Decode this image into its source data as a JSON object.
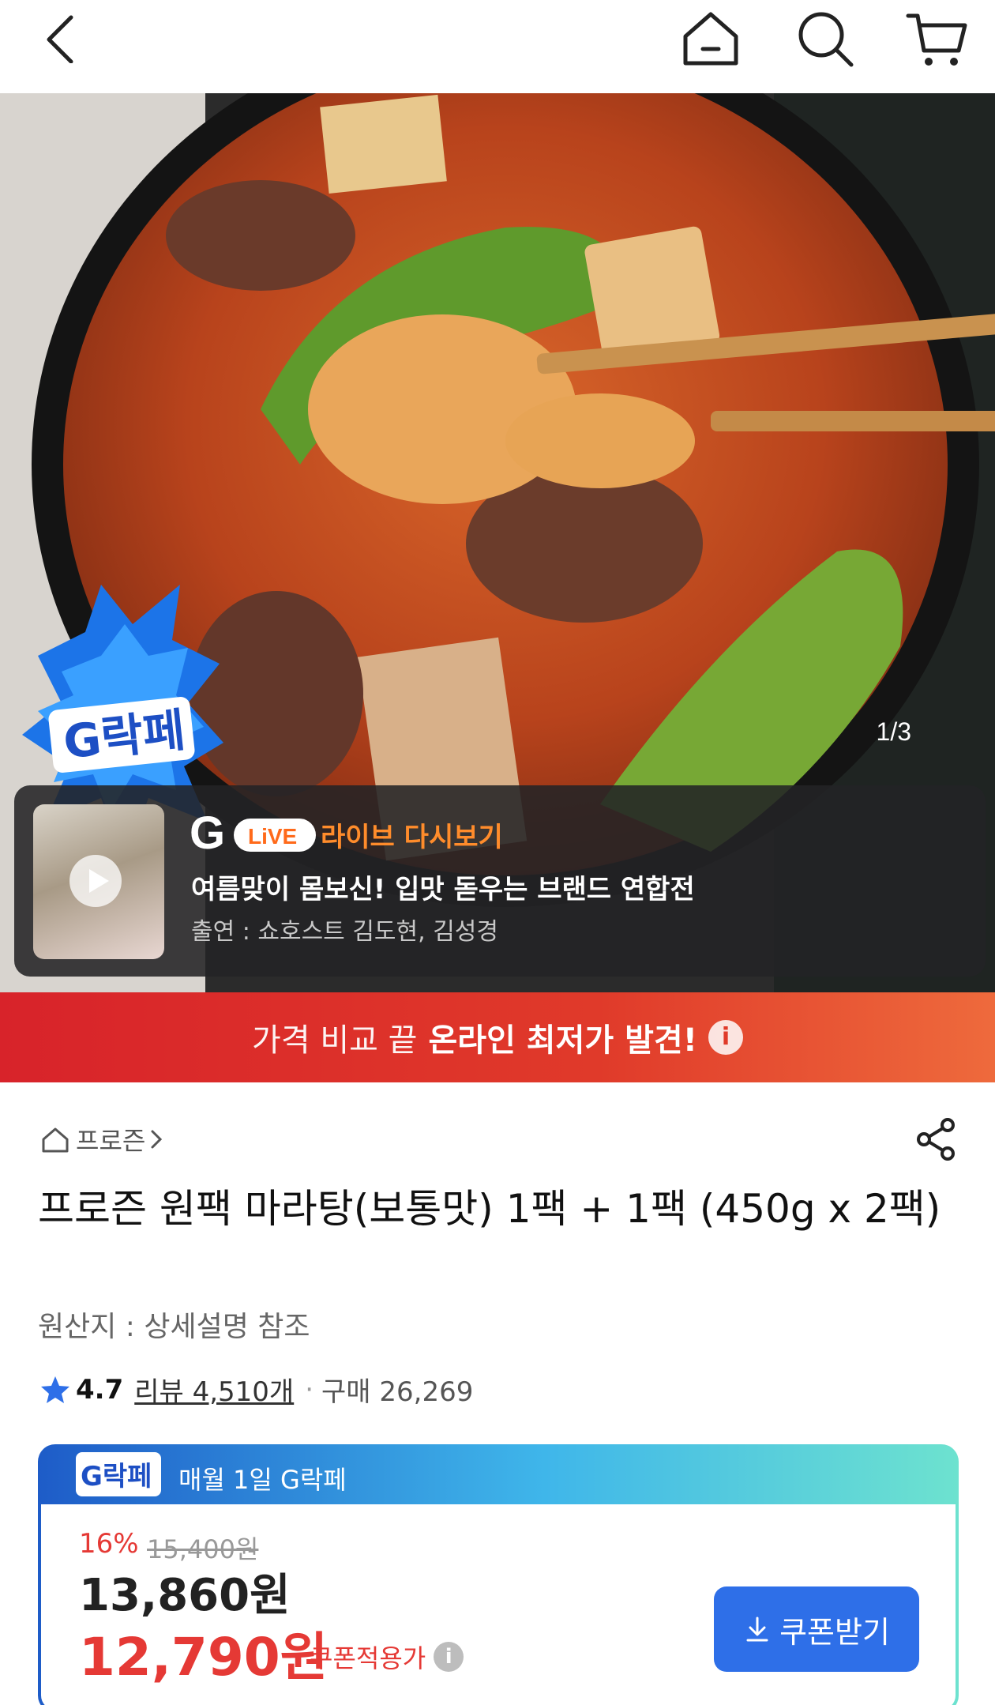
{
  "nav": {
    "back_icon": "chevron-left-icon",
    "home_icon": "home-icon",
    "search_icon": "search-icon",
    "cart_icon": "cart-icon"
  },
  "hero": {
    "page_indicator": "1/3",
    "badge_text": "G락페",
    "live": {
      "logo_letter": "G",
      "logo_badge": "LiVE",
      "replay_label": "라이브 다시보기",
      "title": "여름맞이 몸보신! 입맛 돋우는 브랜드 연합전",
      "cast": "출연 : 쇼호스트 김도현, 김성경"
    }
  },
  "banner": {
    "lead": "가격 비교 끝",
    "strong": "온라인 최저가 발견!",
    "info_glyph": "i"
  },
  "product": {
    "category": "프로즌",
    "title": "프로즌 원팩 마라탕(보통맛) 1팩 + 1팩 (450g x 2팩)",
    "origin": "원산지 : 상세설명 참조",
    "rating": "4.7",
    "review": "리뷰 4,510개",
    "separator": "·",
    "sold": "구매 26,269"
  },
  "deal": {
    "logo_text": "G락페",
    "headline": "매월 1일 G락페",
    "discount": "16%",
    "original_price": "15,400원",
    "price": "13,860원",
    "coupon_price": "12,790원",
    "coupon_label": "쿠폰적용가",
    "info_glyph": "i",
    "coupon_button": "쿠폰받기"
  },
  "colors": {
    "banner_red": "#d8232a",
    "accent_blue": "#2e6fe8",
    "price_red": "#e53935",
    "live_orange": "#ff8c2b"
  }
}
